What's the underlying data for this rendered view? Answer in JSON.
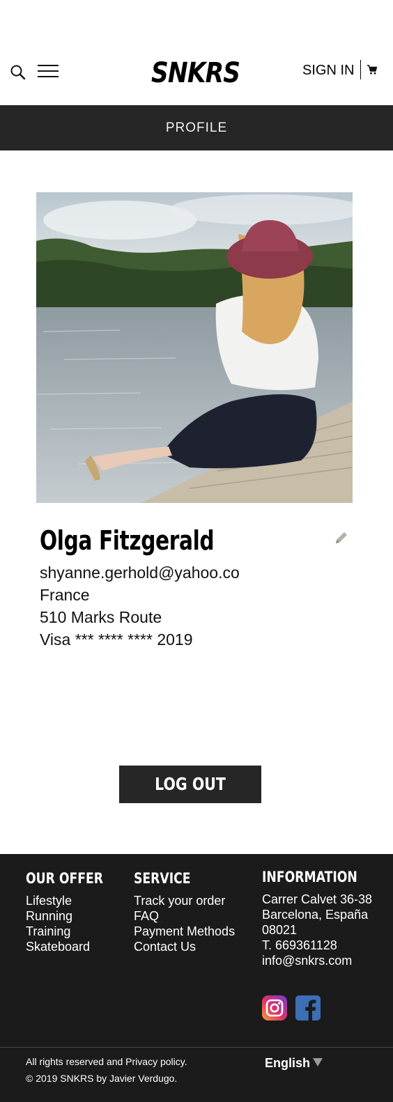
{
  "header": {
    "logo": "SNKRS",
    "signin_label": "SIGN IN",
    "icons": {
      "search": "search-icon",
      "menu": "hamburger-menu-icon",
      "cart": "shopping-cart-icon"
    }
  },
  "page_bar": {
    "title": "PROFILE"
  },
  "profile": {
    "name": "Olga Fitzgerald",
    "email": "shyanne.gerhold@yahoo.co",
    "country": "France",
    "address": "510 Marks Route",
    "card": "Visa *** **** **** 2019",
    "edit_icon": "pencil-icon"
  },
  "logout_label": "LOG OUT",
  "footer": {
    "offer": {
      "heading": "OUR OFFER",
      "items": [
        "Lifestyle",
        "Running",
        "Training",
        "Skateboard"
      ]
    },
    "service": {
      "heading": "SERVICE",
      "items": [
        "Track your order",
        "FAQ",
        "Payment Methods",
        "Contact Us"
      ]
    },
    "information": {
      "heading": "INFORMATION",
      "lines": [
        "Carrer Calvet 36-38",
        "Barcelona, España",
        "08021",
        "T. 669361128",
        "info@snkrs.com"
      ]
    },
    "social": [
      "instagram-icon",
      "facebook-icon"
    ],
    "rights": "All rights reserved and Privacy policy.",
    "copyright": "© 2019 SNKRS by Javier Verdugo.",
    "language": "English"
  },
  "colors": {
    "dark_bar": "#262626",
    "footer_bg": "#1c1b1c",
    "facebook": "#3b6fb6"
  }
}
